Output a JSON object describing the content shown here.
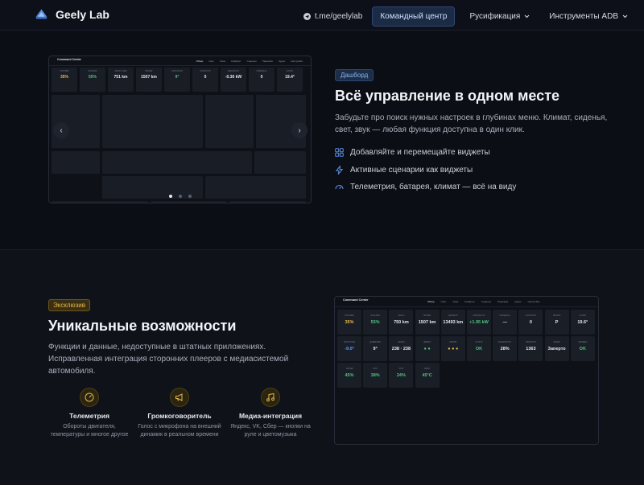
{
  "header": {
    "brand": "Geely Lab",
    "links": {
      "telegram": "t.me/geelylab",
      "command_center": "Командный центр",
      "localization": "Русификация",
      "adb": "Инструменты ADB"
    }
  },
  "dashboard_section": {
    "badge": "Дашборд",
    "title": "Всё управление в одном месте",
    "description": "Забудьте про поиск нужных настроек в глубинах меню. Климат, сиденья, свет, звук — любая функция доступна в один клик.",
    "features": [
      {
        "icon": "grid-icon",
        "text": "Добавляйте и перемещайте виджеты"
      },
      {
        "icon": "bolt-icon",
        "text": "Активные сценарии как виджеты"
      },
      {
        "icon": "gauge-icon",
        "text": "Телеметрия, батарея, климат — всё на виду"
      }
    ],
    "preview": {
      "title": "Command Center",
      "tabs": [
        "Обзор",
        "Свет",
        "Окна",
        "Комфорт",
        "Сиденья",
        "Парковка",
        "Аудио",
        "Настройки"
      ],
      "tiles": [
        {
          "label": "ТОПЛИВО",
          "value": "35%",
          "color": "#e8b94b"
        },
        {
          "label": "БАТАРЕЯ",
          "value": "55%",
          "color": "#4fc47f"
        },
        {
          "label": "ЗАПАС ХОДА",
          "value": "751 km",
          "color": "#e4e7ee"
        },
        {
          "label": "ПРОБЕГ",
          "value": "1507 km",
          "color": "#e4e7ee"
        },
        {
          "label": "НАРУЖНАЯ",
          "value": "9°",
          "color": "#4fc47f"
        },
        {
          "label": "СКОРОСТЬ",
          "value": "0",
          "color": "#e4e7ee"
        },
        {
          "label": "МОЩНОСТЬ",
          "value": "-0.36 kW",
          "color": "#e4e7ee"
        },
        {
          "label": "ПЕРЕДАЧА",
          "value": "0",
          "color": "#e4e7ee"
        },
        {
          "label": "САЛОН",
          "value": "19.4°",
          "color": "#e4e7ee"
        }
      ],
      "slide_dots": [
        true,
        false,
        false
      ]
    }
  },
  "exclusive_section": {
    "badge": "Эксклюзив",
    "title": "Уникальные возможности",
    "description": "Функции и данные, недоступные в штатных приложениях. Исправленная интеграция сторонних плееров с медиасистемой автомобиля.",
    "cards": [
      {
        "icon": "gauge-icon",
        "title": "Телеметрия",
        "desc": "Обороты двигателя, температуры и многое другое"
      },
      {
        "icon": "megaphone-icon",
        "title": "Громкоговоритель",
        "desc": "Голос с микрофона на внешний динамик в реальном времени"
      },
      {
        "icon": "music-icon",
        "title": "Медиа-интеграция",
        "desc": "Яндекс, VK, Сбер — кнопки на руле и цветомузыка"
      }
    ],
    "preview": {
      "title": "Command Center",
      "tabs": [
        "Обзор",
        "Свет",
        "Окна",
        "Комфорт",
        "Сиденья",
        "Парковка",
        "Аудио",
        "Настройки"
      ],
      "tiles": [
        {
          "label": "ТОПЛИВО",
          "value": "35%",
          "color": "#e8b94b"
        },
        {
          "label": "БАТАРЕЯ",
          "value": "55%",
          "color": "#4fc47f"
        },
        {
          "label": "ЗАПАС",
          "value": "750 km",
          "color": "#e4e7ee"
        },
        {
          "label": "ПРОБЕГ",
          "value": "1507 km",
          "color": "#e4e7ee"
        },
        {
          "label": "ОДОМЕТР",
          "value": "13493 km",
          "color": "#e4e7ee"
        },
        {
          "label": "МОЩНОСТЬ",
          "value": "+1.95 kW",
          "color": "#4fc47f"
        },
        {
          "label": "ПЕРЕДАЧА",
          "value": "—",
          "color": "#e4e7ee"
        },
        {
          "label": "СКОРОСТЬ",
          "value": "0",
          "color": "#e4e7ee"
        },
        {
          "label": "РЕЖИМ",
          "value": "P",
          "color": "#e4e7ee"
        },
        {
          "label": "САЛОН",
          "value": "19.6°",
          "color": "#e4e7ee"
        },
        {
          "label": "НАРУЖНАЯ",
          "value": "-9.0°",
          "color": "#5aa0ff"
        },
        {
          "label": "ДАВЛЕНИЕ",
          "value": "9°",
          "color": "#e4e7ee"
        },
        {
          "label": "ШИНЫ",
          "value": "238 · 238",
          "color": "#e4e7ee"
        },
        {
          "label": "ДВЕРИ",
          "value": "● ●",
          "color": "#4fc47f"
        },
        {
          "label": "РЕМНИ",
          "value": "● ● ●",
          "color": "#e8b94b"
        },
        {
          "label": "СТАТУС",
          "value": "OK",
          "color": "#4fc47f"
        },
        {
          "label": "ВЛАЖНОСТЬ",
          "value": "28%",
          "color": "#e4e7ee"
        },
        {
          "label": "ОБОРОТЫ",
          "value": "1363",
          "color": "#e4e7ee"
        },
        {
          "label": "ЗАМОК",
          "value": "Заперто",
          "color": "#e4e7ee"
        },
        {
          "label": "ЗАРЯДКА",
          "value": "OK",
          "color": "#4fc47f"
        },
        {
          "label": "ЗАРЯД",
          "value": "45%",
          "color": "#4fc47f"
        },
        {
          "label": "SOC",
          "value": "38%",
          "color": "#4fc47f"
        },
        {
          "label": "SOH",
          "value": "24%",
          "color": "#4fc47f"
        },
        {
          "label": "ТЕМП.",
          "value": "45°C",
          "color": "#4fc47f"
        }
      ]
    }
  }
}
